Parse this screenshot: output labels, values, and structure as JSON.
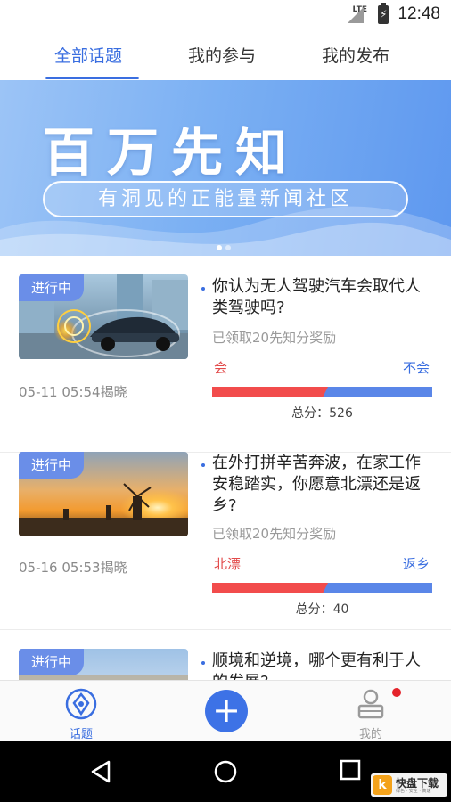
{
  "status_bar": {
    "network": "LTE",
    "time": "12:48"
  },
  "tabs": [
    {
      "label": "全部话题",
      "active": true
    },
    {
      "label": "我的参与",
      "active": false
    },
    {
      "label": "我的发布",
      "active": false
    }
  ],
  "banner": {
    "title": "百万先知",
    "subtitle": "有洞见的正能量新闻社区",
    "slide_count": 2,
    "active_slide": 1
  },
  "topics": [
    {
      "status": "进行中",
      "date": "05-11 05:54揭晓",
      "question": "你认为无人驾驶汽车会取代人类驾驶吗?",
      "reward": "已领取20先知分奖励",
      "option_a": "会",
      "option_b": "不会",
      "a_share": 0.5,
      "total": "总分：526",
      "image": "driverless-car-photo"
    },
    {
      "status": "进行中",
      "date": "05-16 05:53揭晓",
      "question": "在外打拼辛苦奔波，在家工作安稳踏实，你愿意北漂还是返乡?",
      "reward": "已领取20先知分奖励",
      "option_a": "北漂",
      "option_b": "返乡",
      "a_share": 0.5,
      "total": "总分：40",
      "image": "windmill-sunset-photo"
    },
    {
      "status": "进行中",
      "question": "顺境和逆境，哪个更有利于人的发展?",
      "image": "sky-landscape-photo"
    }
  ],
  "bottom_nav": {
    "topics_label": "话题",
    "mine_label": "我的",
    "add_icon": "plus-icon",
    "has_notification": true
  },
  "watermark": {
    "name": "快盘下载",
    "slogan": "绿色 · 安全 · 高速"
  },
  "colors": {
    "accent": "#3a6ee0",
    "option_a": "#f24c4c",
    "option_b": "#5a86e8"
  }
}
